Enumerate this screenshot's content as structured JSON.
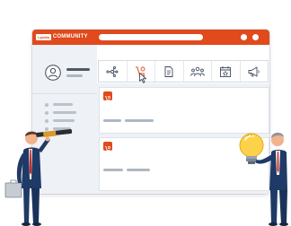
{
  "app": {
    "logo_text": "I-pedia",
    "title": "COMMUNITY"
  },
  "window_controls": [
    "dot",
    "dot"
  ],
  "sidebar": {
    "avatar_icon": "user-icon",
    "items": [
      "item",
      "item",
      "item",
      "item"
    ]
  },
  "toolbar": {
    "tools": [
      {
        "icon": "network-icon"
      },
      {
        "icon": "idea-cart-icon",
        "selected": true
      },
      {
        "icon": "document-icon"
      },
      {
        "icon": "team-icon"
      },
      {
        "icon": "calendar-icon"
      },
      {
        "icon": "megaphone-icon"
      }
    ]
  },
  "posts": [
    {
      "icon": "idea-cart-icon"
    },
    {
      "icon": "idea-cart-icon"
    }
  ],
  "colors": {
    "brand": "#e04a1c",
    "panel": "#eef1f5",
    "icon": "#3d4a5c"
  }
}
